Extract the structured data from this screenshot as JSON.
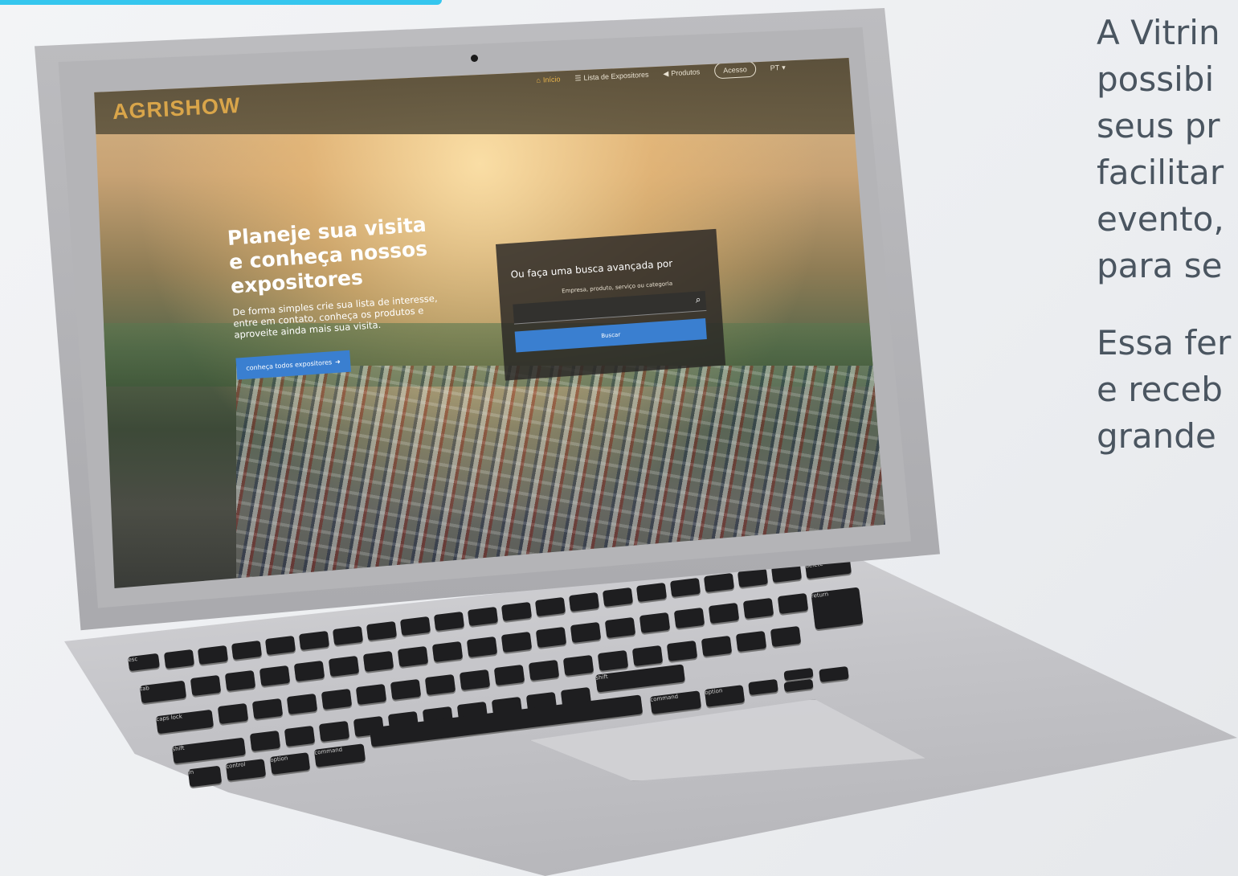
{
  "page": {
    "side_text": {
      "lines_1": [
        "A Vitrin",
        "possibi",
        "seus pr",
        "facilitar",
        "evento,",
        "para se"
      ],
      "lines_2": [
        "Essa fer",
        "e receb",
        "grande"
      ]
    }
  },
  "screen": {
    "logo": "AGRISHOW",
    "nav": {
      "home_label": "Início",
      "exhibitors_label": "Lista de Expositores",
      "products_label": "Produtos",
      "access_label": "Acesso",
      "language": "PT"
    },
    "hero": {
      "title": "Planeje sua visita e conheça nossos expositores",
      "description": "De forma simples crie sua lista de interesse, entre em contato, conheça os produtos e aproveite ainda mais sua visita.",
      "button_label": "conheça todos expositores"
    },
    "search": {
      "title": "Ou faça uma busca avançada por",
      "subtitle": "Empresa, produto, serviço ou categoria",
      "button_label": "Buscar"
    }
  },
  "keyboard": {
    "labels": [
      "esc",
      "tab",
      "caps lock",
      "shift",
      "fn",
      "control",
      "option",
      "command",
      "command",
      "option",
      "return",
      "shift",
      "delete"
    ]
  },
  "colors": {
    "accent": "#35c6ee",
    "button_blue": "#3a7fd0",
    "logo_gold": "#d9a54a",
    "text_gray": "#4a5560"
  }
}
